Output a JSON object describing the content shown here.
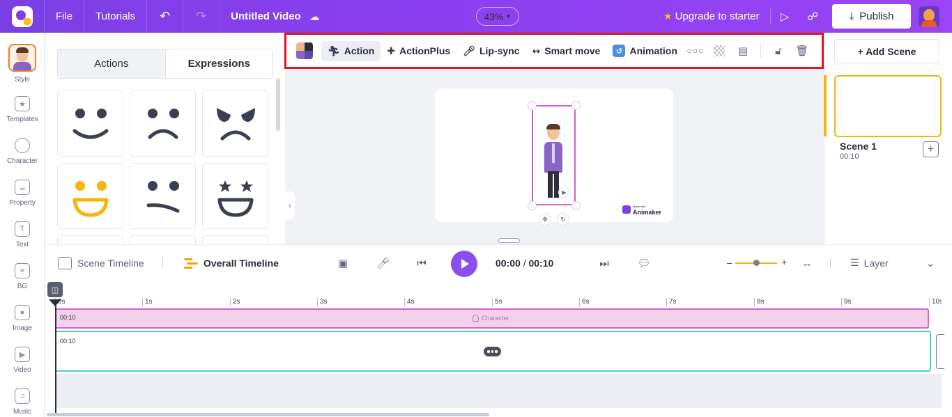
{
  "topbar": {
    "menu": [
      "File",
      "Tutorials"
    ],
    "title": "Untitled Video",
    "zoom": "43%",
    "upgrade_label": "Upgrade to starter",
    "publish_label": "Publish"
  },
  "leftnav": {
    "items": [
      "Style",
      "Templates",
      "Character",
      "Property",
      "Text",
      "BG",
      "Image",
      "Video",
      "Music"
    ]
  },
  "panel": {
    "tabs": [
      "Actions",
      "Expressions"
    ],
    "active_tab": "Expressions",
    "expressions": [
      "happy-face",
      "sad-face",
      "angry-face",
      "grin-face",
      "unsure-face",
      "star-eyes-face"
    ]
  },
  "toolbar": {
    "buttons": [
      "Action",
      "ActionPlus",
      "Lip-sync",
      "Smart move",
      "Animation"
    ],
    "active": "Action"
  },
  "canvas": {
    "watermark_small": "Made with",
    "watermark_brand": "Animaker"
  },
  "scenes": {
    "add_label": "+ Add Scene",
    "items": [
      {
        "name": "Scene 1",
        "duration": "00:10"
      }
    ]
  },
  "timeline": {
    "scene_timeline_label": "Scene Timeline",
    "overall_timeline_label": "Overall Timeline",
    "current_time": "00:00",
    "separator": "/",
    "total_time": "00:10",
    "layer_label": "Layer",
    "ruler": [
      "0s",
      "1s",
      "2s",
      "3s",
      "4s",
      "5s",
      "6s",
      "7s",
      "8s",
      "9s",
      "10s"
    ],
    "tracks": {
      "character": {
        "time": "00:10",
        "label": "Character"
      },
      "event": {
        "time": "00:10"
      }
    }
  },
  "colors": {
    "brand": "#8b3ff0",
    "accent_yellow": "#f5b50e",
    "highlight_red": "#e0151f",
    "character_track": "#f4d1ea",
    "event_track_border": "#45d6b4"
  }
}
